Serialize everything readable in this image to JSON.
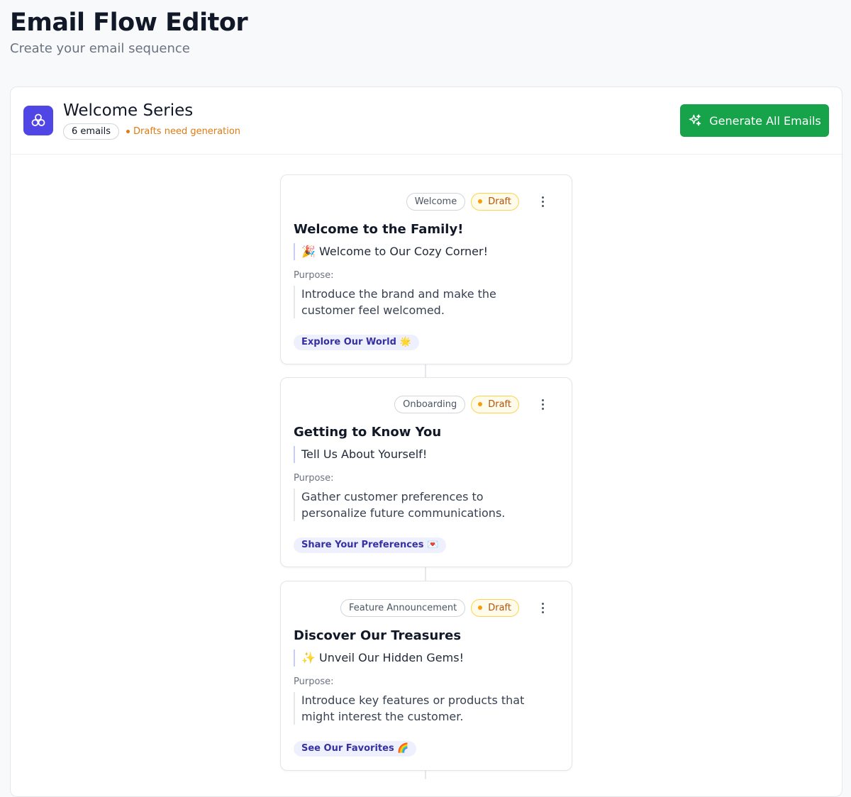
{
  "header": {
    "title": "Email Flow Editor",
    "subtitle": "Create your email sequence"
  },
  "flow": {
    "icon": "sequence-flow-icon",
    "name": "Welcome Series",
    "email_count": "6 emails",
    "status_note": "Drafts need generation",
    "generate_button": "Generate All Emails",
    "generate_icon": "sparkles-icon"
  },
  "colors": {
    "accent": "#4f46e5",
    "generate": "#16a34a",
    "draft": "#f59e0b",
    "warning_text": "#e07b12"
  },
  "emails": [
    {
      "type": "Welcome",
      "status": "Draft",
      "title": "Welcome to the Family!",
      "subject": "🎉 Welcome to Our Cozy Corner!",
      "purpose_label": "Purpose:",
      "purpose": "Introduce the brand and make the customer feel welcomed.",
      "cta": "Explore Our World 🌟"
    },
    {
      "type": "Onboarding",
      "status": "Draft",
      "title": "Getting to Know You",
      "subject": "Tell Us About Yourself!",
      "purpose_label": "Purpose:",
      "purpose": "Gather customer preferences to personalize future communications.",
      "cta": "Share Your Preferences 💌"
    },
    {
      "type": "Feature Announcement",
      "status": "Draft",
      "title": "Discover Our Treasures",
      "subject": "✨ Unveil Our Hidden Gems!",
      "purpose_label": "Purpose:",
      "purpose": "Introduce key features or products that might interest the customer.",
      "cta": "See Our Favorites 🌈"
    }
  ]
}
